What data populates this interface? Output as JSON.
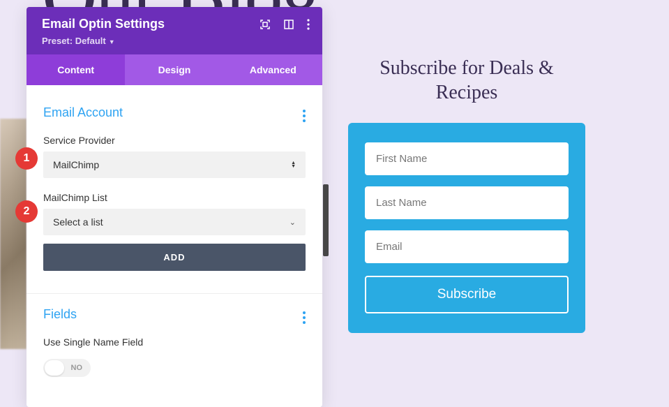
{
  "background": {
    "blog_title_fragment": "Our Blog"
  },
  "panel": {
    "title": "Email Optin Settings",
    "preset_label": "Preset: Default",
    "tabs": {
      "content": "Content",
      "design": "Design",
      "advanced": "Advanced"
    }
  },
  "email_account": {
    "section_title": "Email Account",
    "provider_label": "Service Provider",
    "provider_value": "MailChimp",
    "list_label": "MailChimp List",
    "list_value": "Select a list",
    "add_button": "ADD"
  },
  "fields_section": {
    "section_title": "Fields",
    "single_name_label": "Use Single Name Field",
    "toggle_text": "NO"
  },
  "markers": {
    "one": "1",
    "two": "2"
  },
  "preview": {
    "title": "Subscribe for Deals & Recipes",
    "first_name_ph": "First Name",
    "last_name_ph": "Last Name",
    "email_ph": "Email",
    "button": "Subscribe"
  },
  "colors": {
    "purple_dark": "#6c2eb9",
    "purple_light": "#a259e6",
    "blue_link": "#2ea3f2",
    "blue_box": "#29abe2",
    "red_marker": "#e53935"
  }
}
